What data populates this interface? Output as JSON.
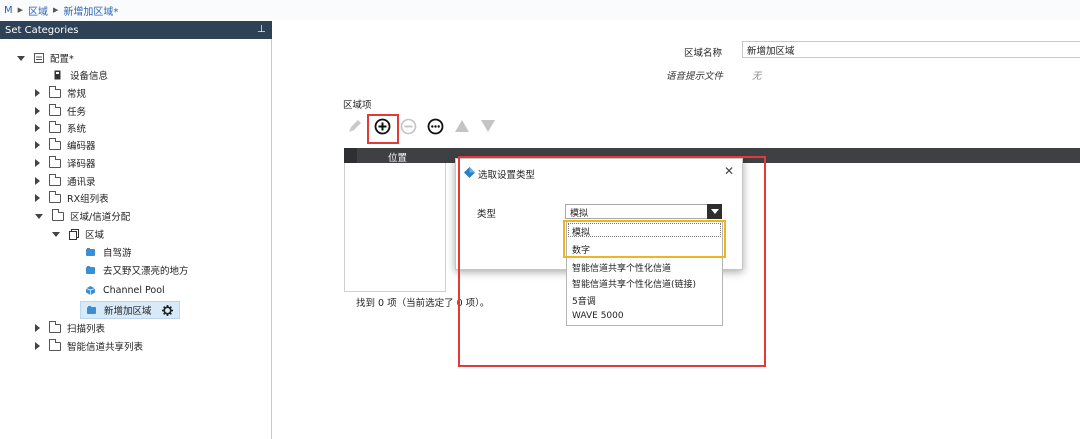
{
  "breadcrumb": [
    "M",
    "区域",
    "新增加区域*"
  ],
  "left_panel": {
    "title": "Set Categories",
    "tree": [
      {
        "label": "配置*"
      },
      {
        "label": "设备信息"
      },
      {
        "label": "常规"
      },
      {
        "label": "任务"
      },
      {
        "label": "系统"
      },
      {
        "label": "编码器"
      },
      {
        "label": "译码器"
      },
      {
        "label": "通讯录"
      },
      {
        "label": "RX组列表"
      },
      {
        "label": "区域/信道分配"
      },
      {
        "label": "区域"
      },
      {
        "label": "自驾游"
      },
      {
        "label": "去又野又漂亮的地方"
      },
      {
        "label": "Channel Pool"
      },
      {
        "label": "新增加区域"
      },
      {
        "label": "扫描列表"
      },
      {
        "label": "智能信道共享列表"
      }
    ]
  },
  "form": {
    "zone_name_label": "区域名称",
    "zone_name_value": "新增加区域",
    "voice_prompt_label": "语音提示文件",
    "voice_prompt_value": "无"
  },
  "zone_items": {
    "label": "区域项",
    "column_header": "位置",
    "status": "找到 0 项（当前选定了 0 项）。"
  },
  "dialog": {
    "title": "选取设置类型",
    "type_label": "类型",
    "selected": "模拟",
    "options": [
      "模拟",
      "数字",
      "智能信道共享个性化信道",
      "智能信道共享个性化信道(链接)",
      "5音调",
      "WAVE 5000"
    ]
  },
  "colors": {
    "panel_header": "#2e4257",
    "highlight_red": "#e03b3b",
    "highlight_yellow": "#f0b323",
    "link_blue": "#2b63b6"
  }
}
